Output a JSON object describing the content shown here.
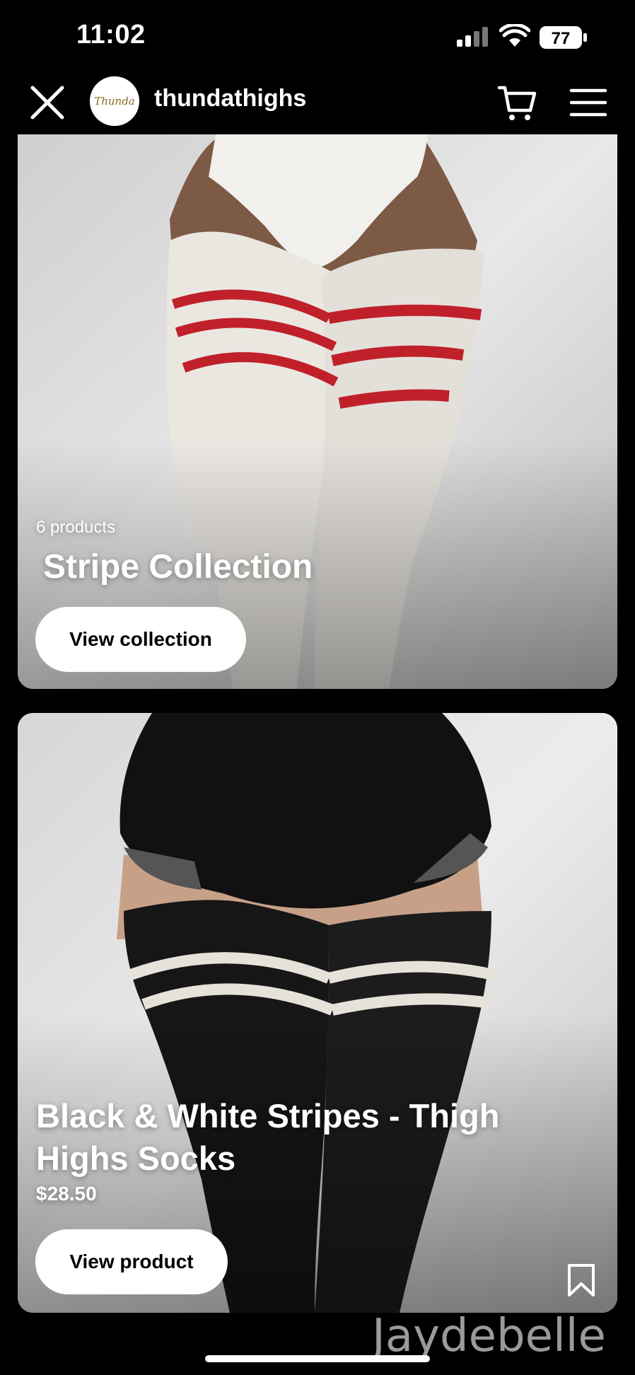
{
  "status_bar": {
    "time": "11:02",
    "battery": "77"
  },
  "header": {
    "shop_name": "thundathighs",
    "logo_text": "Thunda"
  },
  "collection_card": {
    "product_count": "6 products",
    "title": "Stripe Collection",
    "button_label": "View collection",
    "stripe_color": "#c0202a"
  },
  "product_card": {
    "title": "Black & White Stripes - Thigh Highs Socks",
    "price": "$28.50",
    "button_label": "View product"
  },
  "watermark": "Jaydebelle"
}
